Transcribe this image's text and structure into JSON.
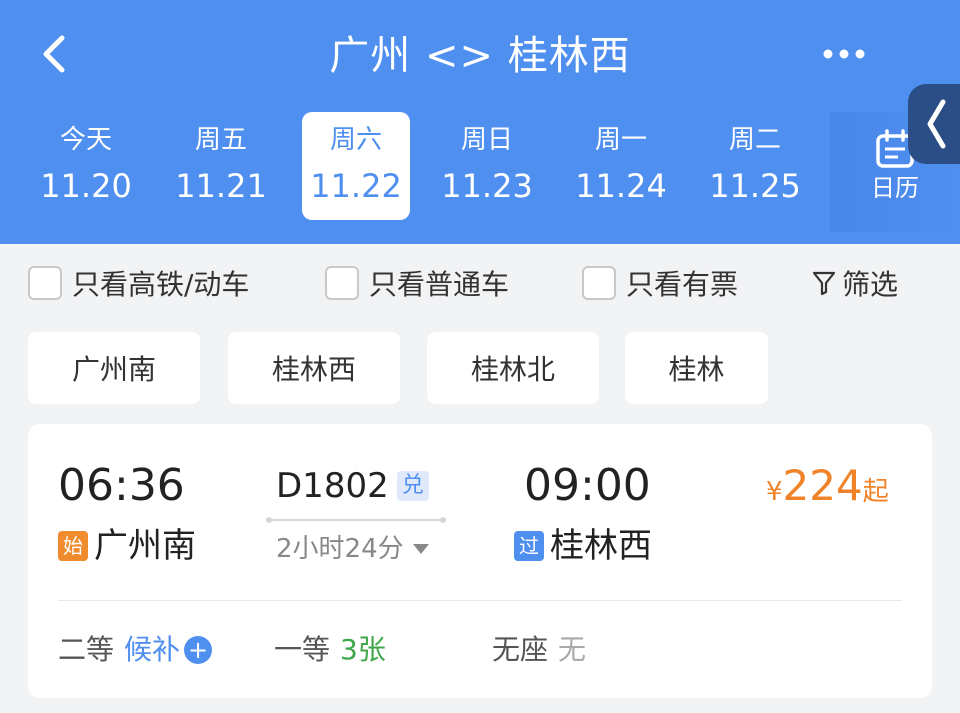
{
  "header": {
    "title": "广州 <> 桂林西",
    "accent": "#4f8ff0"
  },
  "dates": [
    {
      "weekday": "今天",
      "date": "11.20",
      "selected": false
    },
    {
      "weekday": "周五",
      "date": "11.21",
      "selected": false
    },
    {
      "weekday": "周六",
      "date": "11.22",
      "selected": true
    },
    {
      "weekday": "周日",
      "date": "11.23",
      "selected": false
    },
    {
      "weekday": "周一",
      "date": "11.24",
      "selected": false
    },
    {
      "weekday": "周二",
      "date": "11.25",
      "selected": false
    }
  ],
  "calendar": {
    "label": "日历",
    "icon": "calendar-icon"
  },
  "filters": {
    "high_speed_only": "只看高铁/动车",
    "regular_only": "只看普通车",
    "available_only": "只看有票",
    "filter_label": "筛选"
  },
  "stations": [
    "广州南",
    "桂林西",
    "桂林北",
    "桂林"
  ],
  "train": {
    "depart_time": "06:36",
    "arrive_time": "09:00",
    "number": "D1802",
    "badge": "兑",
    "duration": "2小时24分",
    "from_tag": "始",
    "from": "广州南",
    "to_tag": "过",
    "to": "桂林西",
    "price_currency": "¥",
    "price": "224",
    "price_suffix": "起",
    "seats": [
      {
        "class": "二等",
        "status": "候补",
        "status_color": "blue"
      },
      {
        "class": "一等",
        "status": "3张",
        "status_color": "green"
      },
      {
        "class": "无座",
        "status": "无",
        "status_color": "gray"
      }
    ]
  }
}
